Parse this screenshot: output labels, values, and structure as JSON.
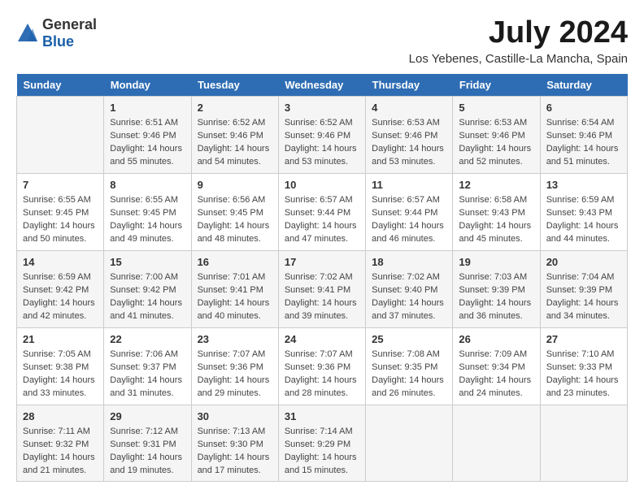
{
  "logo": {
    "general": "General",
    "blue": "Blue"
  },
  "title": "July 2024",
  "subtitle": "Los Yebenes, Castille-La Mancha, Spain",
  "days_of_week": [
    "Sunday",
    "Monday",
    "Tuesday",
    "Wednesday",
    "Thursday",
    "Friday",
    "Saturday"
  ],
  "weeks": [
    [
      {
        "day": "",
        "content": ""
      },
      {
        "day": "1",
        "content": "Sunrise: 6:51 AM\nSunset: 9:46 PM\nDaylight: 14 hours\nand 55 minutes."
      },
      {
        "day": "2",
        "content": "Sunrise: 6:52 AM\nSunset: 9:46 PM\nDaylight: 14 hours\nand 54 minutes."
      },
      {
        "day": "3",
        "content": "Sunrise: 6:52 AM\nSunset: 9:46 PM\nDaylight: 14 hours\nand 53 minutes."
      },
      {
        "day": "4",
        "content": "Sunrise: 6:53 AM\nSunset: 9:46 PM\nDaylight: 14 hours\nand 53 minutes."
      },
      {
        "day": "5",
        "content": "Sunrise: 6:53 AM\nSunset: 9:46 PM\nDaylight: 14 hours\nand 52 minutes."
      },
      {
        "day": "6",
        "content": "Sunrise: 6:54 AM\nSunset: 9:46 PM\nDaylight: 14 hours\nand 51 minutes."
      }
    ],
    [
      {
        "day": "7",
        "content": "Sunrise: 6:55 AM\nSunset: 9:45 PM\nDaylight: 14 hours\nand 50 minutes."
      },
      {
        "day": "8",
        "content": "Sunrise: 6:55 AM\nSunset: 9:45 PM\nDaylight: 14 hours\nand 49 minutes."
      },
      {
        "day": "9",
        "content": "Sunrise: 6:56 AM\nSunset: 9:45 PM\nDaylight: 14 hours\nand 48 minutes."
      },
      {
        "day": "10",
        "content": "Sunrise: 6:57 AM\nSunset: 9:44 PM\nDaylight: 14 hours\nand 47 minutes."
      },
      {
        "day": "11",
        "content": "Sunrise: 6:57 AM\nSunset: 9:44 PM\nDaylight: 14 hours\nand 46 minutes."
      },
      {
        "day": "12",
        "content": "Sunrise: 6:58 AM\nSunset: 9:43 PM\nDaylight: 14 hours\nand 45 minutes."
      },
      {
        "day": "13",
        "content": "Sunrise: 6:59 AM\nSunset: 9:43 PM\nDaylight: 14 hours\nand 44 minutes."
      }
    ],
    [
      {
        "day": "14",
        "content": "Sunrise: 6:59 AM\nSunset: 9:42 PM\nDaylight: 14 hours\nand 42 minutes."
      },
      {
        "day": "15",
        "content": "Sunrise: 7:00 AM\nSunset: 9:42 PM\nDaylight: 14 hours\nand 41 minutes."
      },
      {
        "day": "16",
        "content": "Sunrise: 7:01 AM\nSunset: 9:41 PM\nDaylight: 14 hours\nand 40 minutes."
      },
      {
        "day": "17",
        "content": "Sunrise: 7:02 AM\nSunset: 9:41 PM\nDaylight: 14 hours\nand 39 minutes."
      },
      {
        "day": "18",
        "content": "Sunrise: 7:02 AM\nSunset: 9:40 PM\nDaylight: 14 hours\nand 37 minutes."
      },
      {
        "day": "19",
        "content": "Sunrise: 7:03 AM\nSunset: 9:39 PM\nDaylight: 14 hours\nand 36 minutes."
      },
      {
        "day": "20",
        "content": "Sunrise: 7:04 AM\nSunset: 9:39 PM\nDaylight: 14 hours\nand 34 minutes."
      }
    ],
    [
      {
        "day": "21",
        "content": "Sunrise: 7:05 AM\nSunset: 9:38 PM\nDaylight: 14 hours\nand 33 minutes."
      },
      {
        "day": "22",
        "content": "Sunrise: 7:06 AM\nSunset: 9:37 PM\nDaylight: 14 hours\nand 31 minutes."
      },
      {
        "day": "23",
        "content": "Sunrise: 7:07 AM\nSunset: 9:36 PM\nDaylight: 14 hours\nand 29 minutes."
      },
      {
        "day": "24",
        "content": "Sunrise: 7:07 AM\nSunset: 9:36 PM\nDaylight: 14 hours\nand 28 minutes."
      },
      {
        "day": "25",
        "content": "Sunrise: 7:08 AM\nSunset: 9:35 PM\nDaylight: 14 hours\nand 26 minutes."
      },
      {
        "day": "26",
        "content": "Sunrise: 7:09 AM\nSunset: 9:34 PM\nDaylight: 14 hours\nand 24 minutes."
      },
      {
        "day": "27",
        "content": "Sunrise: 7:10 AM\nSunset: 9:33 PM\nDaylight: 14 hours\nand 23 minutes."
      }
    ],
    [
      {
        "day": "28",
        "content": "Sunrise: 7:11 AM\nSunset: 9:32 PM\nDaylight: 14 hours\nand 21 minutes."
      },
      {
        "day": "29",
        "content": "Sunrise: 7:12 AM\nSunset: 9:31 PM\nDaylight: 14 hours\nand 19 minutes."
      },
      {
        "day": "30",
        "content": "Sunrise: 7:13 AM\nSunset: 9:30 PM\nDaylight: 14 hours\nand 17 minutes."
      },
      {
        "day": "31",
        "content": "Sunrise: 7:14 AM\nSunset: 9:29 PM\nDaylight: 14 hours\nand 15 minutes."
      },
      {
        "day": "",
        "content": ""
      },
      {
        "day": "",
        "content": ""
      },
      {
        "day": "",
        "content": ""
      }
    ]
  ]
}
